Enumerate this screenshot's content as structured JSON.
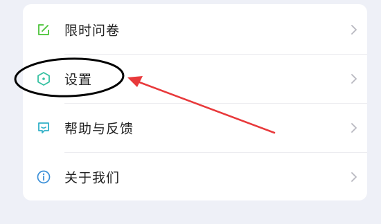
{
  "menu": {
    "items": [
      {
        "label": "限时问卷",
        "icon": "edit-survey-icon",
        "icon_color": "#5cc94b"
      },
      {
        "label": "设置",
        "icon": "hexagon-settings-icon",
        "icon_color": "#33c0a0"
      },
      {
        "label": "帮助与反馈",
        "icon": "feedback-chat-icon",
        "icon_color": "#30b0c8"
      },
      {
        "label": "关于我们",
        "icon": "info-icon",
        "icon_color": "#3a8fd8"
      }
    ]
  },
  "annotation": {
    "color": "#e8393b",
    "ellipse_color": "#000000"
  }
}
